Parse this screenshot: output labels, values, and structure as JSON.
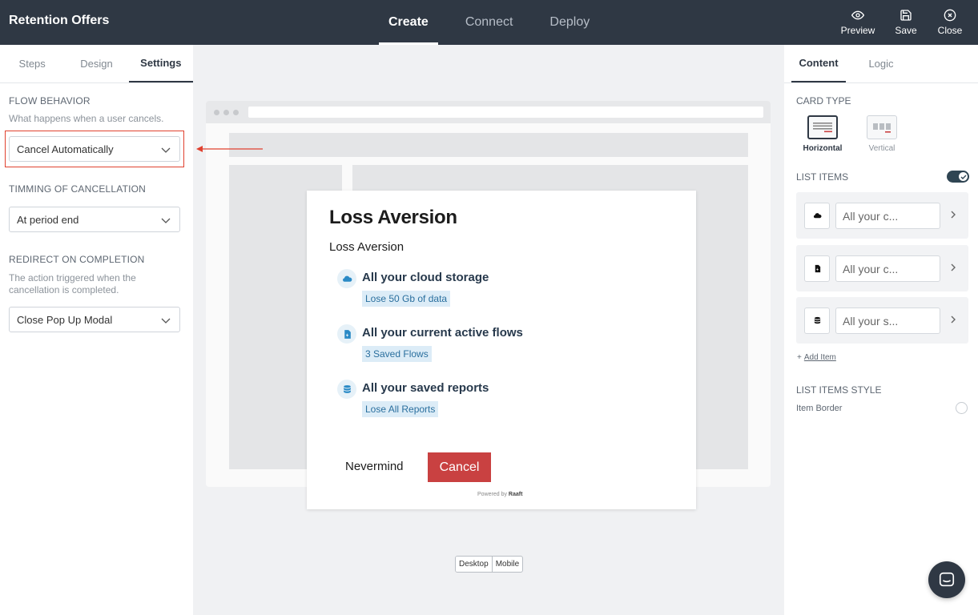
{
  "header": {
    "title": "Retention Offers",
    "tabs": [
      {
        "label": "Create",
        "active": true
      },
      {
        "label": "Connect",
        "active": false
      },
      {
        "label": "Deploy",
        "active": false
      }
    ],
    "actions": {
      "preview": {
        "label": "Preview",
        "icon": "eye-icon"
      },
      "save": {
        "label": "Save",
        "icon": "floppy-disk-icon"
      },
      "close": {
        "label": "Close",
        "icon": "close-circle-icon"
      }
    }
  },
  "left_panel": {
    "tabs": [
      {
        "label": "Steps",
        "active": false
      },
      {
        "label": "Design",
        "active": false
      },
      {
        "label": "Settings",
        "active": true
      }
    ],
    "flow_behavior": {
      "title": "FLOW BEHAVIOR",
      "description": "What happens when a user cancels.",
      "value": "Cancel Automatically"
    },
    "timing": {
      "title": "TIMMING OF CANCELLATION",
      "value": "At period end"
    },
    "redirect": {
      "title": "REDIRECT ON COMPLETION",
      "description": "The action triggered when the cancellation is completed.",
      "value": "Close Pop Up Modal"
    }
  },
  "preview": {
    "modal": {
      "title": "Loss Aversion",
      "subtitle": "Loss Aversion",
      "offers": [
        {
          "title": "All your cloud storage",
          "badge": "Lose 50 Gb of data",
          "icon": "cloud-icon"
        },
        {
          "title": "All your current active flows",
          "badge": "3 Saved Flows",
          "icon": "file-bolt-icon"
        },
        {
          "title": "All your saved reports",
          "badge": "Lose All Reports",
          "icon": "database-icon"
        }
      ],
      "nevermind_label": "Nevermind",
      "cancel_label": "Cancel",
      "powered_by": "Powered by",
      "brand": "Raaft"
    },
    "device_toggle": {
      "desktop": "Desktop",
      "mobile": "Mobile"
    }
  },
  "right_panel": {
    "tabs": [
      {
        "label": "Content",
        "active": true
      },
      {
        "label": "Logic",
        "active": false
      }
    ],
    "card_type": {
      "title": "CARD TYPE",
      "options": [
        {
          "label": "Horizontal",
          "selected": true
        },
        {
          "label": "Vertical",
          "selected": false
        }
      ]
    },
    "list_items": {
      "title": "LIST ITEMS",
      "enabled": true,
      "items": [
        {
          "value": "All your c...",
          "icon": "cloud-icon"
        },
        {
          "value": "All your c...",
          "icon": "file-bolt-icon"
        },
        {
          "value": "All your s...",
          "icon": "database-icon"
        }
      ],
      "add_label": "Add Item"
    },
    "list_items_style": {
      "title": "LIST ITEMS STYLE",
      "item_border_label": "Item Border",
      "item_border_enabled": false
    }
  },
  "colors": {
    "header_bg": "#2f3844",
    "cancel_button": "#c94141",
    "highlight": "#e0412f",
    "badge_bg": "#dcecf7"
  }
}
